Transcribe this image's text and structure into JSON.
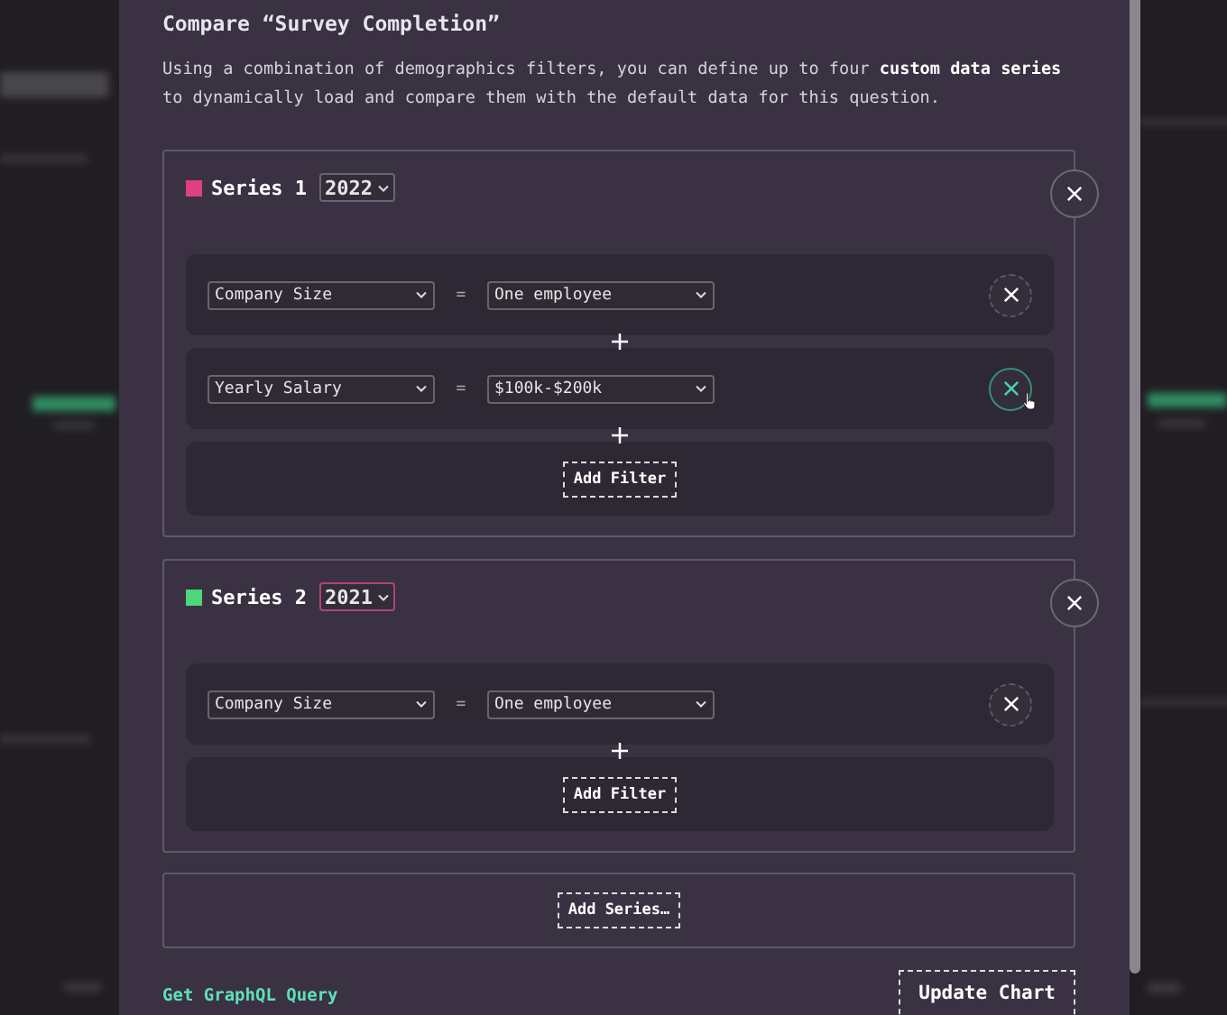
{
  "dialog": {
    "title": "Compare “Survey Completion”",
    "description": "Using a combination of demographics filters, you can define up to four **custom data series** to dynamically load and compare them with the default data for this question."
  },
  "series": [
    {
      "name": "Series 1",
      "color": "#e0407e",
      "year": "2022",
      "focused": false,
      "filters": [
        {
          "field": "Company Size",
          "operator": "=",
          "value": "One employee",
          "hovered": false
        },
        {
          "field": "Yearly Salary",
          "operator": "=",
          "value": "$100k-$200k",
          "hovered": true
        }
      ],
      "add_filter": "Add Filter"
    },
    {
      "name": "Series 2",
      "color": "#4fd67a",
      "year": "2021",
      "focused": true,
      "filters": [
        {
          "field": "Company Size",
          "operator": "=",
          "value": "One employee",
          "hovered": false
        }
      ],
      "add_filter": "Add Filter"
    }
  ],
  "add_series": "Add Series…",
  "footer": {
    "link": "Get GraphQL Query",
    "button": "Update Chart"
  }
}
